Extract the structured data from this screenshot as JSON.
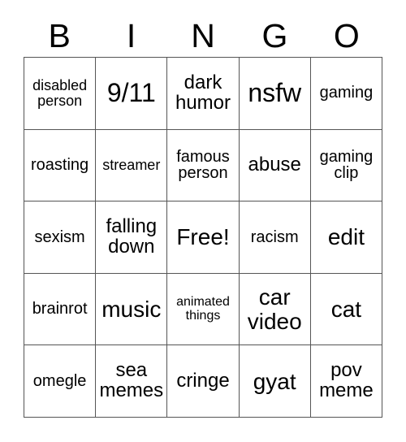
{
  "card": {
    "header": {
      "letters": [
        "B",
        "I",
        "N",
        "G",
        "O"
      ]
    },
    "rows": [
      [
        {
          "label": "disabled person",
          "size": "fs-s"
        },
        {
          "label": "9/11",
          "size": "fs-xxl"
        },
        {
          "label": "dark humor",
          "size": "fs-l"
        },
        {
          "label": "nsfw",
          "size": "fs-xxl"
        },
        {
          "label": "gaming",
          "size": "fs-m"
        }
      ],
      [
        {
          "label": "roasting",
          "size": "fs-m"
        },
        {
          "label": "streamer",
          "size": "fs-s"
        },
        {
          "label": "famous person",
          "size": "fs-m"
        },
        {
          "label": "abuse",
          "size": "fs-l"
        },
        {
          "label": "gaming clip",
          "size": "fs-m"
        }
      ],
      [
        {
          "label": "sexism",
          "size": "fs-m"
        },
        {
          "label": "falling down",
          "size": "fs-l"
        },
        {
          "label": "Free!",
          "size": "fs-xl"
        },
        {
          "label": "racism",
          "size": "fs-m"
        },
        {
          "label": "edit",
          "size": "fs-xl"
        }
      ],
      [
        {
          "label": "brainrot",
          "size": "fs-m"
        },
        {
          "label": "music",
          "size": "fs-xl"
        },
        {
          "label": "animated things",
          "size": "fs-xs"
        },
        {
          "label": "car video",
          "size": "fs-xl"
        },
        {
          "label": "cat",
          "size": "fs-xl"
        }
      ],
      [
        {
          "label": "omegle",
          "size": "fs-m"
        },
        {
          "label": "sea memes",
          "size": "fs-l"
        },
        {
          "label": "cringe",
          "size": "fs-l"
        },
        {
          "label": "gyat",
          "size": "fs-xl"
        },
        {
          "label": "pov meme",
          "size": "fs-l"
        }
      ]
    ]
  }
}
